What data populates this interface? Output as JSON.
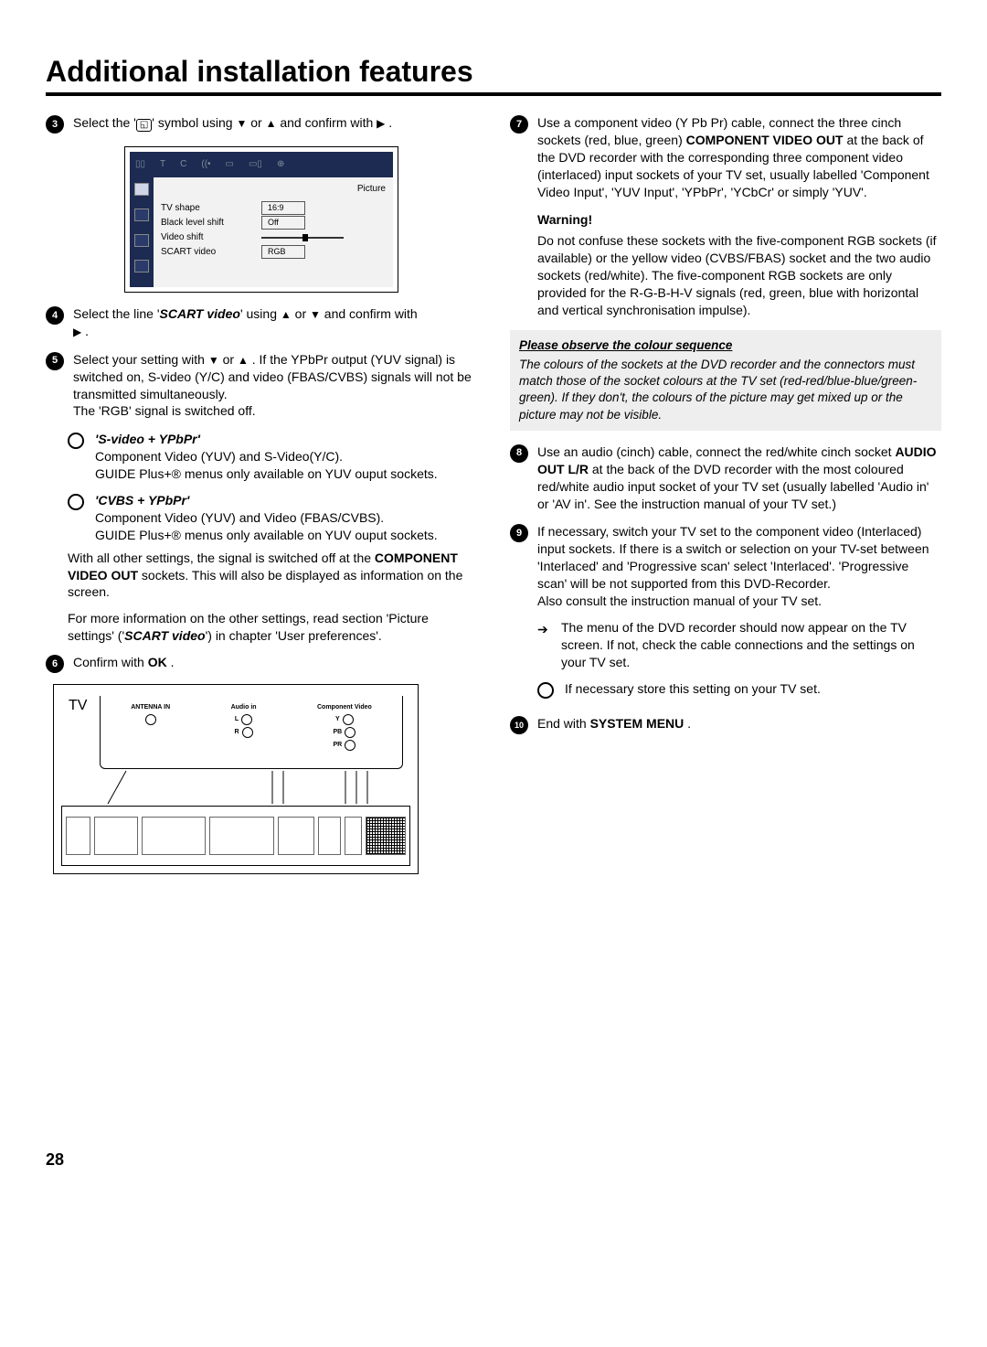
{
  "title": "Additional installation features",
  "page_number": "28",
  "left": {
    "step3": {
      "pre": "Select the '",
      "post": "' symbol using ",
      "conf": " and confirm with "
    },
    "osd": {
      "heading": "Picture",
      "rows": {
        "r1_label": "TV shape",
        "r1_val": "16:9",
        "r2_label": "Black level shift",
        "r2_val": "Off",
        "r3_label": "Video shift",
        "r4_label": "SCART video",
        "r4_val": "RGB"
      },
      "tabs": {
        "b": "T",
        "c": "C"
      }
    },
    "step4": {
      "a": "Select the line '",
      "scart": "SCART video",
      "b": "' using ",
      "c": " or ",
      "d": " and confirm with "
    },
    "step5": {
      "a": "Select your setting with ",
      "b": " or ",
      "c": " . If the YPbPr output (YUV signal) is switched on, S-video (Y/C) and video (FBAS/CVBS) signals will not be transmitted simultaneously.",
      "d": "The 'RGB' signal is switched off."
    },
    "opt1_title": "S-video + YPbPr",
    "opt1_l1": "Component Video (YUV) and S-Video(Y/C).",
    "opt1_l2": "GUIDE Plus+® menus only available on YUV ouput sockets.",
    "opt2_title": "CVBS + YPbPr",
    "opt2_l1": "Component Video (YUV) and Video (FBAS/CVBS).",
    "opt2_l2": "GUIDE Plus+® menus only available on YUV ouput sockets.",
    "para1a": "With all other settings, the signal is switched off at the ",
    "para1b": "COMPONENT VIDEO OUT",
    "para1c": " sockets. This will also be displayed as information on the screen.",
    "para2a": "For more information on the other settings, read section 'Picture settings' ('",
    "para2b": "SCART video",
    "para2c": "') in chapter 'User preferences'.",
    "step6a": "Confirm with ",
    "step6b": "OK",
    "step6c": " .",
    "diagram": {
      "tv": "TV",
      "ant": "ANTENNA IN",
      "ain": "Audio in",
      "ain_l": "L",
      "ain_r": "R",
      "comp": "Component Video",
      "y": "Y",
      "pb": "PB",
      "pr": "PR"
    }
  },
  "right": {
    "step7a": "Use a component video (Y Pb Pr) cable, connect the three cinch sockets (red, blue, green) ",
    "step7b": "COMPONENT VIDEO OUT",
    "step7c": " at the back of the DVD recorder with the corresponding three component video (interlaced) input sockets of your TV set, usually labelled 'Component Video Input', 'YUV Input', 'YPbPr', 'YCbCr' or simply 'YUV'.",
    "warn_title": "Warning!",
    "warn_text": "Do not confuse these sockets with the five-component RGB sockets (if available) or the yellow video (CVBS/FBAS) socket and the two audio sockets (red/white). The five-component RGB sockets are only provided for the R-G-B-H-V signals (red, green, blue with horizontal and vertical synchronisation impulse).",
    "note_head": "Please observe the colour sequence",
    "note_body": "The colours of the sockets at the DVD recorder and the connectors must match those of the socket colours at the TV set (red-red/blue-blue/green-green). If they don't, the colours of the picture may get mixed up or the picture may not be visible.",
    "step8a": "Use an audio (cinch) cable, connect the red/white cinch socket ",
    "step8b": "AUDIO OUT L/R",
    "step8c": " at the back of the DVD recorder with the most coloured red/white audio input socket of your TV set (usually labelled 'Audio in' or 'AV in'. See the instruction manual of your TV set.)",
    "step9a": "If necessary, switch your TV set to the component video (Interlaced) input sockets. If there is a switch or selection on your TV-set between 'Interlaced' and 'Progressive scan' select 'Interlaced'. 'Progressive scan' will be not supported from this DVD-Recorder.",
    "step9b": "Also consult the instruction manual of your TV set.",
    "sub_arrow": "The menu of the DVD recorder should now appear on the TV screen. If not, check the cable connections and the settings on your TV set.",
    "sub_circ": "If necessary store this setting on your TV set.",
    "step10a": "End with ",
    "step10b": "SYSTEM MENU",
    "step10c": " ."
  }
}
